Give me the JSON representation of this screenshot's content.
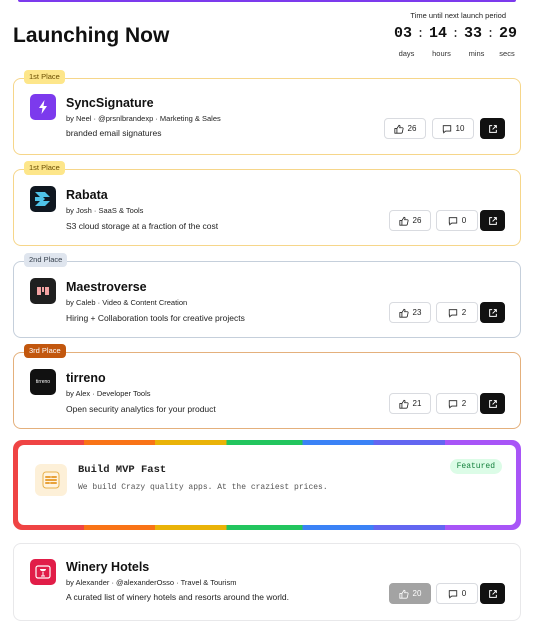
{
  "header": {
    "title": "Launching Now",
    "timer_label": "Time until next launch period",
    "days": "03",
    "hours": "14",
    "mins": "33",
    "secs": "29",
    "separator": ":",
    "units": [
      "days",
      "hours",
      "mins",
      "secs"
    ]
  },
  "products": [
    {
      "badge": "1st Place",
      "name": "SyncSignature",
      "meta": "by Neel · @prsnlbrandexp · Marketing & Sales",
      "desc": "branded email signatures",
      "upvotes": "26",
      "comments": "10",
      "logo_icon": "lightning-bolt-icon",
      "logo_color": "#7c3aed"
    },
    {
      "badge": "1st Place",
      "name": "Rabata",
      "meta": "by Josh · SaaS & Tools",
      "desc": "S3 cloud storage at a fraction of the cost",
      "upvotes": "26",
      "comments": "0",
      "logo_icon": "rabata-logo-icon",
      "logo_color": "#0f1720"
    },
    {
      "badge": "2nd Place",
      "name": "Maestroverse",
      "meta": "by Caleb · Video & Content Creation",
      "desc": "Hiring + Collaboration tools for creative projects",
      "upvotes": "23",
      "comments": "2",
      "logo_icon": "maestroverse-logo-icon",
      "logo_color": "#1f1f1f"
    },
    {
      "badge": "3rd Place",
      "name": "tirreno",
      "meta": "by Alex · Developer Tools",
      "desc": "Open security analytics for your product",
      "upvotes": "21",
      "comments": "2",
      "logo_icon": "tirreno-logo-icon",
      "logo_color": "#111111",
      "logo_text": "tirreno"
    }
  ],
  "featured": {
    "name": "Build MVP Fast",
    "desc": "We build Crazy quality apps. At the craziest prices.",
    "tag": "Featured",
    "logo_icon": "mvp-logo-icon"
  },
  "extra": {
    "name": "Winery Hotels",
    "meta": "by Alexander · @alexanderOsso · Travel & Tourism",
    "desc": "A curated list of winery hotels and resorts around the world.",
    "upvotes": "20",
    "comments": "0",
    "logo_icon": "winery-logo-icon",
    "logo_color": "#e11d48"
  },
  "colors": {
    "gold_border": "#f6d68a",
    "silver_border": "#c5cfdb",
    "bronze_border": "#e4b07c",
    "accent": "#7c3aed",
    "featured_green": "#15803d"
  }
}
